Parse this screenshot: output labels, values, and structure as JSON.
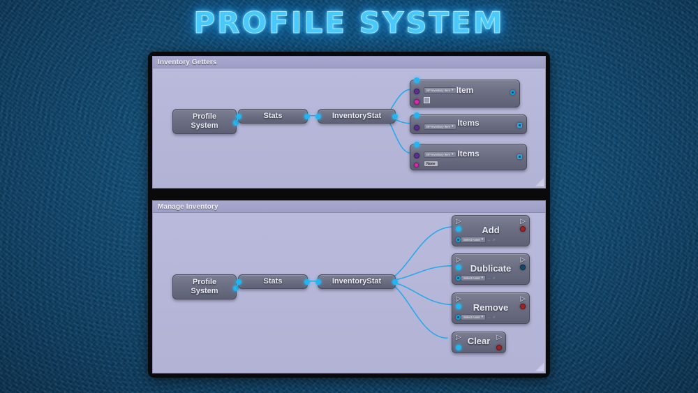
{
  "page": {
    "title": "PROFILE SYSTEM",
    "background_color": "#0e4d78",
    "title_color": "#49c8fb",
    "frame_color": "#0a0a0c"
  },
  "panels": [
    {
      "id": "inventory-getters",
      "header": "Inventory Getters",
      "nodes": [
        {
          "id": "profile-system",
          "title": "Profile\nSystem"
        },
        {
          "id": "stats",
          "title": "Stats"
        },
        {
          "id": "inventory-stat",
          "title": "InventoryStat"
        },
        {
          "id": "item",
          "title": "Item",
          "combo": "BP Inventory Item",
          "combo_arrow": "▾",
          "checkbox": true
        },
        {
          "id": "items-1",
          "title": "Items",
          "combo": "BP Inventory Item",
          "combo_arrow": "▾"
        },
        {
          "id": "items-2",
          "title": "Items",
          "combo": "BP Inventory Item",
          "combo_arrow": "▾",
          "chip": "None"
        }
      ]
    },
    {
      "id": "manage-inventory",
      "header": "Manage Inventory",
      "nodes": [
        {
          "id": "profile-system",
          "title": "Profile\nSystem"
        },
        {
          "id": "stats",
          "title": "Stats"
        },
        {
          "id": "inventory-stat",
          "title": "InventoryStat"
        },
        {
          "id": "add",
          "title": "Add",
          "exec_in": "▷",
          "exec_out": "▷",
          "asset": "Select Asset",
          "asset_arrow": "▾",
          "asset_icon_back": "←",
          "asset_icon_search": "⌕"
        },
        {
          "id": "dublicate",
          "title": "Dublicate",
          "exec_in": "▷",
          "exec_out": "▷",
          "asset": "Select Asset",
          "asset_arrow": "▾",
          "asset_icon_back": "←",
          "asset_icon_search": "⌕"
        },
        {
          "id": "remove",
          "title": "Remove",
          "exec_in": "▷",
          "exec_out": "▷",
          "asset": "Select Asset",
          "asset_arrow": "▾",
          "asset_icon_back": "←",
          "asset_icon_search": "⌕"
        },
        {
          "id": "clear",
          "title": "Clear",
          "exec_in": "▷",
          "exec_out": "▷"
        }
      ]
    }
  ],
  "colors": {
    "wire": "#2aa8e8",
    "pin_cyan": "#22b5f0",
    "pin_purple": "#5b2e8f",
    "pin_magenta": "#d42bb0",
    "pin_red": "#9e2323",
    "node_body": "#6c6f83",
    "canvas": "#b6b6da",
    "header": "#a3a3ca"
  }
}
